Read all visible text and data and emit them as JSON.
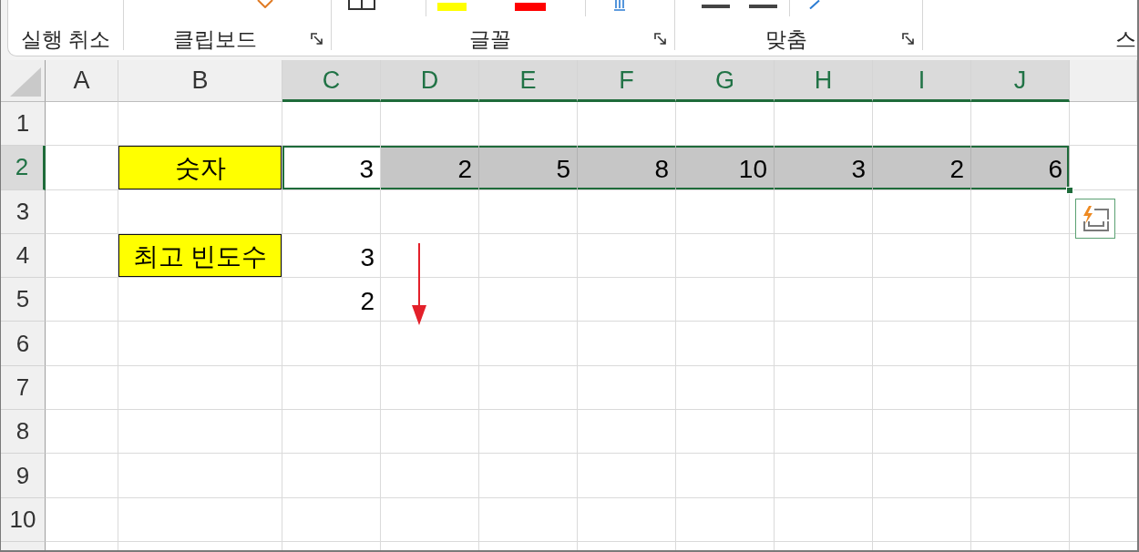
{
  "ribbon": {
    "groups": [
      {
        "label": "실행 취소",
        "launcher": false
      },
      {
        "label": "클립보드",
        "launcher": true
      },
      {
        "label": "글꼴",
        "launcher": true
      },
      {
        "label": "맞춤",
        "launcher": true
      },
      {
        "label": "스",
        "launcher": false
      }
    ]
  },
  "sheet": {
    "columns": [
      {
        "label": "A",
        "selected": false
      },
      {
        "label": "B",
        "selected": false
      },
      {
        "label": "C",
        "selected": true
      },
      {
        "label": "D",
        "selected": true
      },
      {
        "label": "E",
        "selected": true
      },
      {
        "label": "F",
        "selected": true
      },
      {
        "label": "G",
        "selected": true
      },
      {
        "label": "H",
        "selected": true
      },
      {
        "label": "I",
        "selected": true
      },
      {
        "label": "J",
        "selected": true
      },
      {
        "selected": false
      }
    ],
    "rows": [
      {
        "label": "1",
        "selected": false
      },
      {
        "label": "2",
        "selected": true,
        "cells": [
          null,
          {
            "kind": "label",
            "text": "숫자",
            "selected": false,
            "active": false
          },
          {
            "kind": "number",
            "text": "3",
            "selected": true,
            "active": true
          },
          {
            "kind": "number",
            "text": "2",
            "selected": true,
            "active": false
          },
          {
            "kind": "number",
            "text": "5",
            "selected": true,
            "active": false
          },
          {
            "kind": "number",
            "text": "8",
            "selected": true,
            "active": false
          },
          {
            "kind": "number",
            "text": "10",
            "selected": true,
            "active": false
          },
          {
            "kind": "number",
            "text": "3",
            "selected": true,
            "active": false
          },
          {
            "kind": "number",
            "text": "2",
            "selected": true,
            "active": false
          },
          {
            "kind": "number",
            "text": "6",
            "selected": true,
            "active": false
          }
        ]
      },
      {
        "label": "3",
        "selected": false
      },
      {
        "label": "4",
        "selected": false,
        "cells": [
          null,
          {
            "kind": "label",
            "text": "최고 빈도수",
            "selected": false,
            "active": false
          },
          {
            "kind": "number",
            "text": "3",
            "selected": false,
            "active": false
          }
        ]
      },
      {
        "label": "5",
        "selected": false,
        "cells": [
          null,
          null,
          {
            "kind": "number",
            "text": "2",
            "selected": false,
            "active": false
          }
        ]
      },
      {
        "label": "6",
        "selected": false
      },
      {
        "label": "7",
        "selected": false
      },
      {
        "label": "8",
        "selected": false
      },
      {
        "label": "9",
        "selected": false
      },
      {
        "label": "10",
        "selected": false
      }
    ]
  }
}
